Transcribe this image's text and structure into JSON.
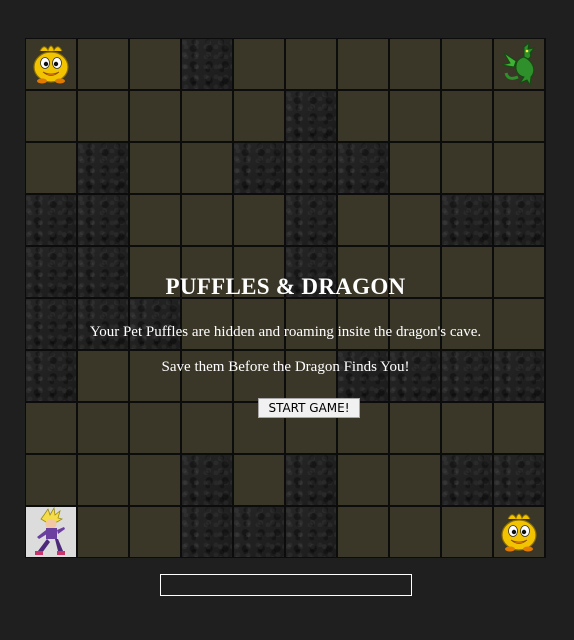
{
  "game": {
    "title": "PUFFLES & DRAGON",
    "intro_line_1": "Your Pet Puffles are hidden and roaming insite the dragon's cave.",
    "intro_line_2": "Save them Before the Dragon Finds You!",
    "start_button_label": "START GAME!",
    "status_text": ""
  },
  "board": {
    "rows": 10,
    "cols": 10,
    "legend": {
      "F": "floor",
      "R": "rock"
    },
    "tiles": [
      "FFFRFFFFFF",
      "FFFFFRFFFF",
      "FRFFRRRFFF",
      "RRFFFRFFRR",
      "RRFFFRFFFF",
      "RRRFFFFFFF",
      "RFFFFFRRRR",
      "FFFFFFFFFF",
      "FFFRFRFFRR",
      "FFFRRRFFFF"
    ],
    "sprites": [
      {
        "row": 0,
        "col": 0,
        "kind": "puffle",
        "icon": "puffle-icon"
      },
      {
        "row": 0,
        "col": 9,
        "kind": "dragon",
        "icon": "dragon-icon"
      },
      {
        "row": 9,
        "col": 0,
        "kind": "player",
        "icon": "player-icon"
      },
      {
        "row": 9,
        "col": 9,
        "kind": "puffle",
        "icon": "puffle-icon"
      }
    ]
  },
  "colors": {
    "background": "#1f1f1f",
    "floor": "#3a3628",
    "rock": "#232323",
    "puffle": "#f2c400",
    "dragon": "#2f8f2a",
    "player": "#6b3fa0",
    "text": "#ffffff"
  }
}
